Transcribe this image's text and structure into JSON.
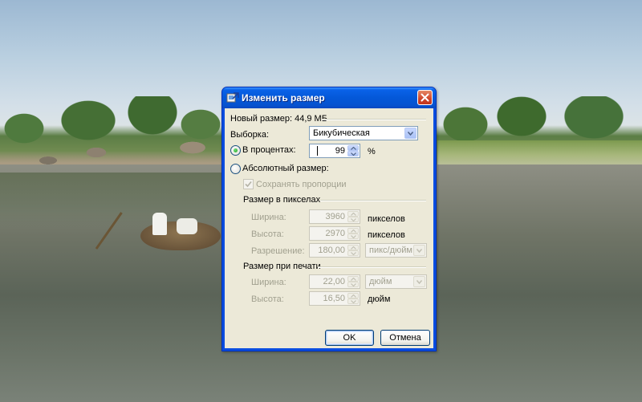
{
  "dialog": {
    "title": "Изменить размер",
    "new_size": "Новый размер: 44,9 МБ",
    "resampling": {
      "label": "Выборка:",
      "value": "Бикубическая"
    },
    "by_percent": {
      "label": "В процентах:",
      "value": "99",
      "unit": "%",
      "selected": true
    },
    "absolute": {
      "label": "Абсолютный размер:",
      "selected": false
    },
    "keep_ratio": {
      "label": "Сохранять пропорции",
      "checked": true
    },
    "pixel_size": {
      "header": "Размер в пикселах",
      "width": {
        "label": "Ширина:",
        "value": "3960",
        "unit": "пикселов"
      },
      "height": {
        "label": "Высота:",
        "value": "2970",
        "unit": "пикселов"
      },
      "resolution": {
        "label": "Разрешение:",
        "value": "180,00",
        "unit": "пикс/дюйм"
      }
    },
    "print_size": {
      "header": "Размер при печати",
      "width": {
        "label": "Ширина:",
        "value": "22,00",
        "unit": "дюйм"
      },
      "height": {
        "label": "Высота:",
        "value": "16,50",
        "unit": "дюйм"
      }
    },
    "ok_label": "OK",
    "cancel_label": "Отмена"
  },
  "colors": {
    "titlebar": "#0458d8",
    "dialog_face": "#ece9d8",
    "disabled_text": "#a1a08f",
    "close_button": "#d0452a"
  }
}
